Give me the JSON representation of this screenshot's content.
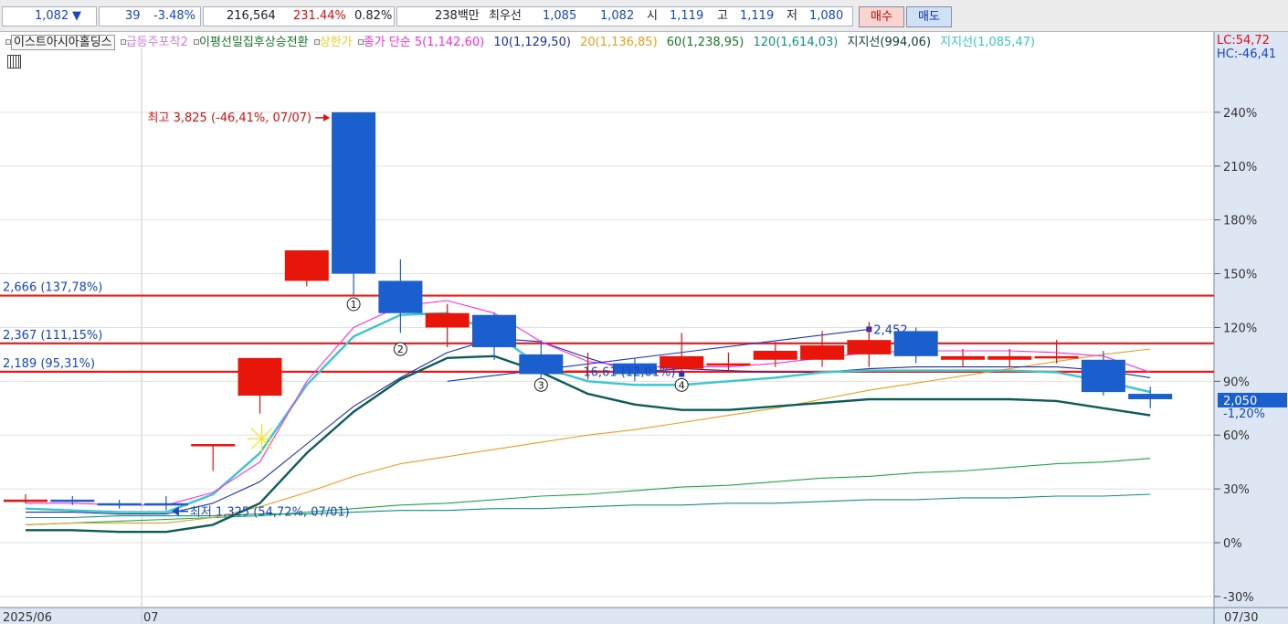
{
  "quote": {
    "price": "1,082",
    "direction": "▼",
    "change": "39",
    "change_pct": "-3.48%",
    "volume": "216,564",
    "volume_ratio": "231.44%",
    "turnover": "0.82%",
    "amount": "238백만",
    "best_label": "최우선",
    "best_ask": "1,085",
    "best_bid": "1,082",
    "open_label": "시",
    "open": "1,119",
    "high_label": "고",
    "high": "1,119",
    "low_label": "저",
    "low": "1,080",
    "buy_label": "매수",
    "sell_label": "매도"
  },
  "legend": {
    "title": "이스트아시아홀딩스",
    "ind1": "급등주포착2",
    "ind2": "이평선밀집후상승전환",
    "ind3": "상한가",
    "ma_label": "종가 단순 5(1,142,60)",
    "ma10": "10(1,129,50)",
    "ma20": "20(1,136,85)",
    "ma60": "60(1,238,95)",
    "ma120": "120(1,614,03)",
    "support1": "지지선(994,06)",
    "support2": "지지선(1,085,47)",
    "lc": "LC:54,72",
    "hc": "HC:-46,41"
  },
  "colors": {
    "up": "#e8150b",
    "down": "#1b5fcf",
    "ma5": "#ff2fe6",
    "ma10": "#1f2fa8",
    "ma20": "#e8a020",
    "ma60": "#1fa84a",
    "ma120": "#14917f",
    "support1": "#0c5d58",
    "support2": "#39c6cc",
    "hline": "#f01818"
  },
  "chart_data": {
    "type": "candlestick",
    "y_axis_unit": "%",
    "y_ticks": [
      240,
      210,
      180,
      150,
      120,
      90,
      60,
      30,
      0,
      -30
    ],
    "x_labels": [
      "2025/06",
      "07",
      "07/30"
    ],
    "current_label": "2,050",
    "current_pct": "-1,20%",
    "candles": [
      {
        "o": 24,
        "c": 24,
        "h": 27,
        "l": 22
      },
      {
        "o": 24,
        "c": 23,
        "h": 26,
        "l": 21
      },
      {
        "o": 22,
        "c": 21,
        "h": 24,
        "l": 19
      },
      {
        "o": 22,
        "c": 21,
        "h": 26,
        "l": 18
      },
      {
        "o": 54,
        "c": 55,
        "h": 55,
        "l": 40
      },
      {
        "o": 82,
        "c": 103,
        "h": 103,
        "l": 72
      },
      {
        "o": 146,
        "c": 163,
        "h": 163,
        "l": 143
      },
      {
        "o": 240,
        "c": 150,
        "h": 240,
        "l": 138
      },
      {
        "o": 146,
        "c": 128,
        "h": 158,
        "l": 117
      },
      {
        "o": 120,
        "c": 128,
        "h": 133,
        "l": 109
      },
      {
        "o": 127,
        "c": 109,
        "h": 128,
        "l": 102
      },
      {
        "o": 105,
        "c": 94,
        "h": 113,
        "l": 89
      },
      {
        "o": 96,
        "c": 96,
        "h": 106,
        "l": 91
      },
      {
        "o": 100,
        "c": 94,
        "h": 103,
        "l": 90
      },
      {
        "o": 97,
        "c": 104,
        "h": 117,
        "l": 95
      },
      {
        "o": 100,
        "c": 100,
        "h": 106,
        "l": 95
      },
      {
        "o": 102,
        "c": 107,
        "h": 112,
        "l": 98
      },
      {
        "o": 102,
        "c": 110,
        "h": 118,
        "l": 98
      },
      {
        "o": 105,
        "c": 113,
        "h": 123,
        "l": 98
      },
      {
        "o": 118,
        "c": 104,
        "h": 120,
        "l": 100
      },
      {
        "o": 102,
        "c": 104,
        "h": 108,
        "l": 98
      },
      {
        "o": 102,
        "c": 104,
        "h": 108,
        "l": 98
      },
      {
        "o": 104,
        "c": 104,
        "h": 113,
        "l": 100
      },
      {
        "o": 102,
        "c": 84,
        "h": 107,
        "l": 82
      },
      {
        "o": 83,
        "c": 80,
        "h": 87,
        "l": 75
      }
    ],
    "lines": {
      "ma5": [
        22,
        22,
        21,
        21,
        28,
        45,
        90,
        120,
        132,
        135,
        128,
        112,
        101,
        98,
        98,
        98,
        100,
        103,
        106,
        107,
        107,
        107,
        106,
        104,
        95
      ],
      "ma10": [
        17,
        17,
        16,
        16,
        22,
        34,
        55,
        76,
        92,
        106,
        114,
        112,
        103,
        95,
        97,
        96,
        95,
        95,
        97,
        98,
        98,
        98,
        98,
        96,
        92
      ],
      "ma20": [
        10,
        11,
        11,
        11,
        14,
        20,
        28,
        37,
        44,
        48,
        52,
        56,
        60,
        63,
        67,
        71,
        75,
        80,
        85,
        89,
        93,
        97,
        101,
        105,
        108
      ],
      "ma60": [
        10,
        11,
        12,
        13,
        14,
        15,
        17,
        19,
        21,
        22,
        24,
        26,
        27,
        29,
        31,
        32,
        34,
        36,
        37,
        39,
        40,
        42,
        44,
        45,
        47
      ],
      "ma120": [
        14,
        14,
        15,
        15,
        15,
        16,
        16,
        17,
        18,
        18,
        19,
        19,
        20,
        21,
        21,
        22,
        22,
        23,
        24,
        24,
        25,
        25,
        26,
        26,
        27
      ],
      "support1": [
        7,
        7,
        6,
        6,
        10,
        22,
        50,
        73,
        91,
        103,
        104,
        95,
        83,
        77,
        74,
        74,
        76,
        78,
        80,
        80,
        80,
        80,
        79,
        75,
        71
      ],
      "support2": [
        19,
        18,
        17,
        17,
        27,
        50,
        88,
        115,
        127,
        128,
        117,
        98,
        90,
        88,
        88,
        90,
        92,
        95,
        96,
        96,
        96,
        96,
        95,
        90,
        84
      ]
    },
    "trend_line": {
      "from_index": 9,
      "to_index": 18,
      "values": [
        90,
        119
      ],
      "label": "2,452",
      "mid_value": 113
    },
    "hlines": [
      {
        "value": 137.78,
        "label": "2,666 (137,78%)"
      },
      {
        "value": 111.15,
        "label": "2,367 (111,15%)"
      },
      {
        "value": 95.31,
        "label": "2,189 (95,31%)"
      }
    ],
    "annotations": {
      "high_label": "최고 3,825 (-46,41%, 07/07)",
      "low_label": "최저 1,325 (54,72%, 07/01)",
      "pivot_label": "16,61 (12,01%)",
      "markers": [
        {
          "index": 7,
          "value": 135,
          "text": "1"
        },
        {
          "index": 8,
          "value": 110,
          "text": "2"
        },
        {
          "index": 11,
          "value": 90,
          "text": "3"
        },
        {
          "index": 14,
          "value": 90,
          "text": "4"
        }
      ]
    }
  }
}
